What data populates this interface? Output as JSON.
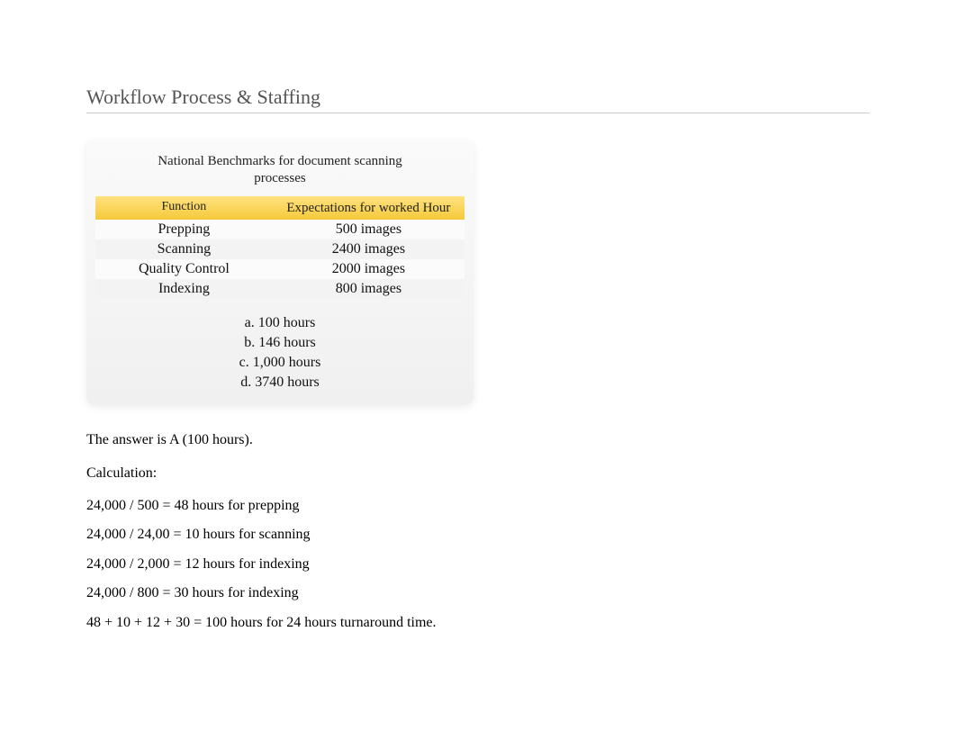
{
  "title": "Workflow Process & Staffing",
  "table": {
    "caption": "National Benchmarks for document scanning processes",
    "headers": {
      "function": "Function",
      "expectation": "Expectations for worked Hour"
    },
    "rows": [
      {
        "function": "Prepping",
        "expectation": "500 images"
      },
      {
        "function": "Scanning",
        "expectation": "2400 images"
      },
      {
        "function": "Quality Control",
        "expectation": "2000 images"
      },
      {
        "function": "Indexing",
        "expectation": "800 images"
      }
    ],
    "options": [
      "a. 100 hours",
      "b. 146 hours",
      "c. 1,000 hours",
      "d. 3740 hours"
    ]
  },
  "body": {
    "answer": "The answer is A (100 hours).",
    "calc_label": "Calculation:",
    "lines": [
      "24,000 / 500 = 48 hours for prepping",
      "24,000 / 24,00 = 10 hours for scanning",
      "24,000 / 2,000 = 12 hours for indexing",
      "24,000 / 800 = 30 hours for indexing",
      "48 + 10 + 12 + 30 = 100 hours for 24 hours turnaround time."
    ]
  }
}
